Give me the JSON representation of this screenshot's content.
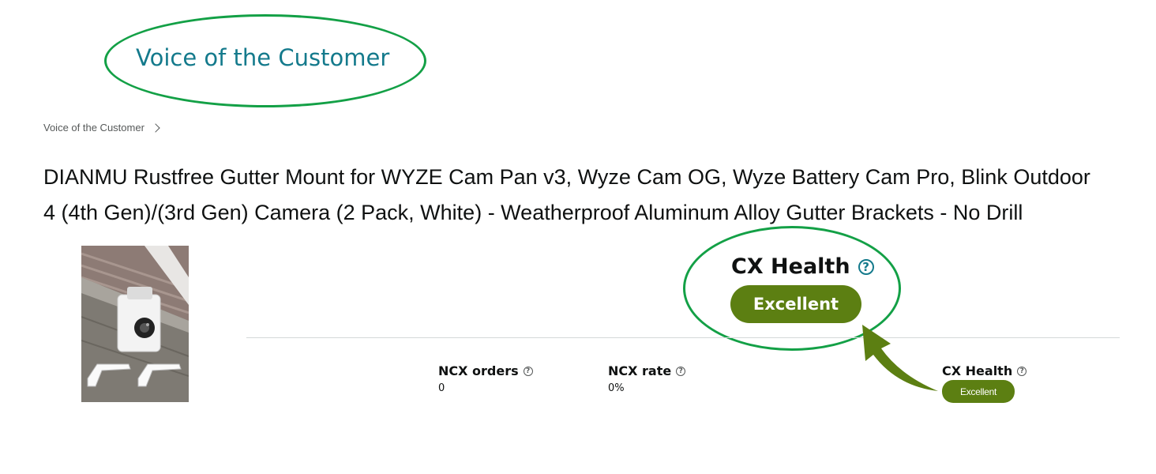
{
  "header": {
    "title": "Voice of the Customer"
  },
  "breadcrumb": {
    "items": [
      "Voice of the Customer"
    ]
  },
  "product": {
    "title_line1": "DIANMU Rustfree Gutter Mount for WYZE Cam Pan v3, Wyze Cam OG, Wyze Battery Cam Pro, Blink Outdoor",
    "title_line2": "4 (4th Gen)/(3rd Gen) Camera (2 Pack, White) - Weatherproof Aluminum Alloy Gutter Brackets - No Drill"
  },
  "cx_health_callout": {
    "label": "CX Health",
    "help_glyph": "?",
    "status": "Excellent"
  },
  "metrics": {
    "ncx_orders": {
      "label": "NCX orders",
      "value": "0",
      "help_glyph": "?"
    },
    "ncx_rate": {
      "label": "NCX rate",
      "value": "0%",
      "help_glyph": "?"
    },
    "cx_health": {
      "label": "CX Health",
      "status": "Excellent",
      "help_glyph": "?"
    }
  },
  "colors": {
    "callout_ring": "#13a046",
    "title_teal": "#147a8c",
    "badge_green": "#5c7f12",
    "arrow_green": "#5c7f12"
  },
  "icons": {
    "breadcrumb_separator": "chevron-right-icon",
    "help": "help-circle-icon",
    "annotation": "curved-arrow-icon"
  }
}
